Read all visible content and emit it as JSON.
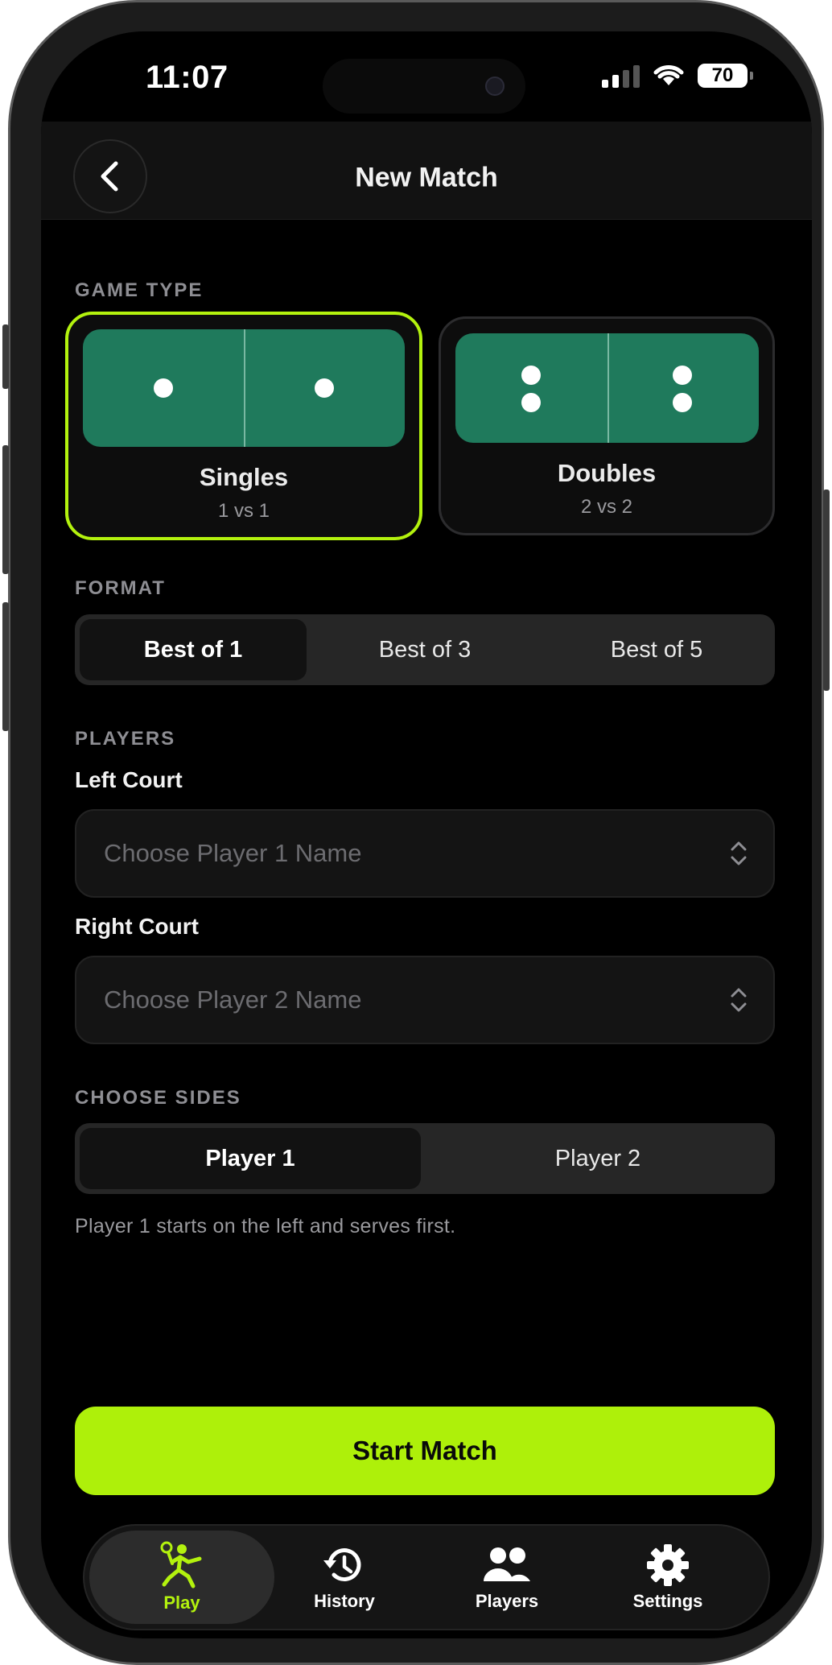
{
  "status_bar": {
    "time": "11:07",
    "battery": "70"
  },
  "header": {
    "title": "New Match"
  },
  "game_type": {
    "label": "GAME TYPE",
    "options": [
      {
        "title": "Singles",
        "subtitle": "1 vs 1",
        "selected": true
      },
      {
        "title": "Doubles",
        "subtitle": "2 vs 2",
        "selected": false
      }
    ]
  },
  "format": {
    "label": "FORMAT",
    "options": [
      "Best of 1",
      "Best of 3",
      "Best of 5"
    ],
    "selected": "Best of 1"
  },
  "players": {
    "label": "PLAYERS",
    "left_court": {
      "label": "Left Court",
      "placeholder": "Choose Player 1 Name"
    },
    "right_court": {
      "label": "Right Court",
      "placeholder": "Choose Player 2 Name"
    }
  },
  "choose_sides": {
    "label": "CHOOSE SIDES",
    "options": [
      "Player 1",
      "Player 2"
    ],
    "selected": "Player 1",
    "hint": "Player 1 starts on the left and serves first."
  },
  "start_button": "Start Match",
  "tabs": [
    {
      "label": "Play",
      "icon": "pickleball-player-icon",
      "active": true
    },
    {
      "label": "History",
      "icon": "history-icon",
      "active": false
    },
    {
      "label": "Players",
      "icon": "people-icon",
      "active": false
    },
    {
      "label": "Settings",
      "icon": "gear-icon",
      "active": false
    }
  ],
  "colors": {
    "accent": "#b3f20e",
    "court": "#1f7a5c",
    "background": "#000000"
  }
}
